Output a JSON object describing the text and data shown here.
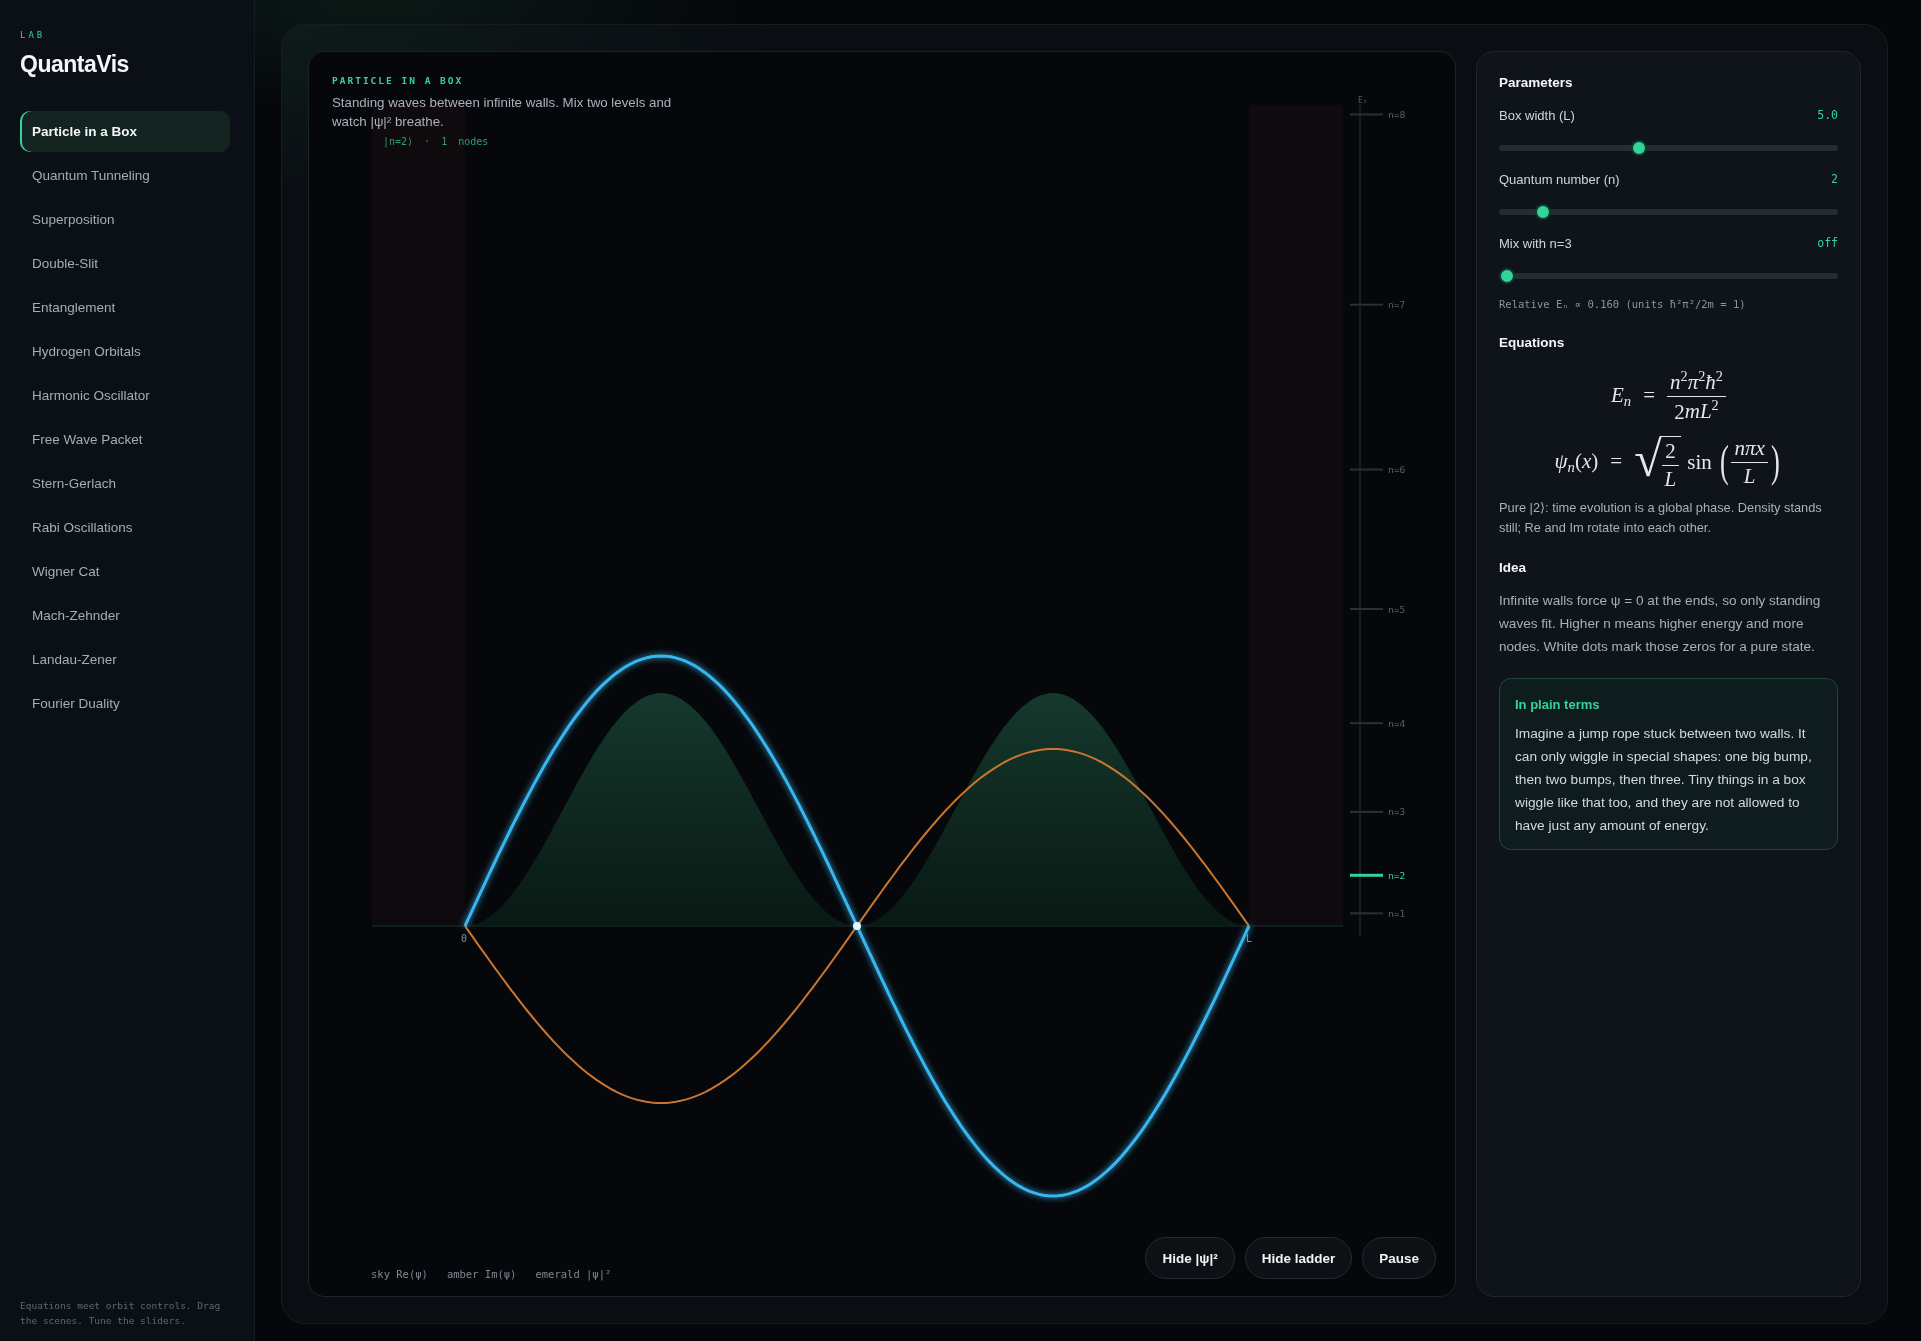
{
  "sidebar": {
    "eyebrow": "LAB",
    "brand": "QuantaVis",
    "items": [
      {
        "label": "Particle in a Box",
        "selected": true
      },
      {
        "label": "Quantum Tunneling",
        "selected": false
      },
      {
        "label": "Superposition",
        "selected": false
      },
      {
        "label": "Double-Slit",
        "selected": false
      },
      {
        "label": "Entanglement",
        "selected": false
      },
      {
        "label": "Hydrogen Orbitals",
        "selected": false
      },
      {
        "label": "Harmonic Oscillator",
        "selected": false
      },
      {
        "label": "Free Wave Packet",
        "selected": false
      },
      {
        "label": "Stern-Gerlach",
        "selected": false
      },
      {
        "label": "Rabi Oscillations",
        "selected": false
      },
      {
        "label": "Wigner Cat",
        "selected": false
      },
      {
        "label": "Mach-Zehnder",
        "selected": false
      },
      {
        "label": "Landau-Zener",
        "selected": false
      },
      {
        "label": "Fourier Duality",
        "selected": false
      }
    ],
    "footer": "Equations meet orbit controls. Drag the scenes. Tune the sliders."
  },
  "scene": {
    "eyebrow": "PARTICLE IN A BOX",
    "description": "Standing waves between infinite walls. Mix two levels and watch |ψ|² breathe.",
    "state_label": "|n=2⟩ · 1 nodes",
    "axis_start": "0",
    "axis_end": "L",
    "energy_ladder": {
      "axis_label": "Eₙ",
      "levels": [
        {
          "label": "n=8",
          "selected": false
        },
        {
          "label": "n=7",
          "selected": false
        },
        {
          "label": "n=6",
          "selected": false
        },
        {
          "label": "n=5",
          "selected": false
        },
        {
          "label": "n=4",
          "selected": false
        },
        {
          "label": "n=3",
          "selected": false
        },
        {
          "label": "n=2",
          "selected": true
        },
        {
          "label": "n=1",
          "selected": false
        }
      ]
    },
    "legend": [
      "sky Re(ψ)",
      "amber Im(ψ)",
      "emerald |ψ|²"
    ],
    "buttons": [
      "Hide |ψ|²",
      "Hide ladder",
      "Pause"
    ]
  },
  "parameters": {
    "title": "Parameters",
    "sliders": [
      {
        "label": "Box width (L)",
        "value": "5.0",
        "level": 0.41
      },
      {
        "label": "Quantum number (n)",
        "value": "2",
        "level": 0.111
      },
      {
        "label": "Mix with n=3",
        "value": "off",
        "level": 0
      }
    ],
    "note": "Relative Eₙ ∝ 0.160 (units ħ²π²/2m = 1)"
  },
  "equations": {
    "title": "Equations",
    "items": [
      {
        "kind": "fraction",
        "lhs": [
          "*E*$_{n}$",
          "="
        ],
        "numerator": [
          "*n*$^{2}$*π*$^{2}$*ħ*$^{2}$"
        ],
        "denominator": [
          "2",
          "*mL*$^{2}$"
        ]
      },
      {
        "kind": "root_sin",
        "lhs": [
          "*ψ*$_{n}$(*x*)",
          "="
        ],
        "radical": "√",
        "root_numerator": [
          "2"
        ],
        "root_denominator": [
          "*L*"
        ],
        "function": "sin",
        "open": "(",
        "arg_numerator": [
          "*nπx*"
        ],
        "arg_denominator": [
          "*L*"
        ],
        "close": ")"
      }
    ],
    "note": "Pure |2⟩: time evolution is a global phase. Density stands still; Re and Im rotate into each other."
  },
  "idea": {
    "title": "Idea",
    "text": "Infinite walls force ψ = 0 at the ends, so only standing waves fit. Higher n means higher energy and more nodes. White dots mark those zeros for a pure state.",
    "callout": {
      "title": "In plain terms",
      "text": "Imagine a jump rope stuck between two walls. It can only wiggle in special shapes: one big bump, then two bumps, then three. Tiny things in a box wiggle like that too, and they are not allowed to have just any amount of energy."
    }
  }
}
